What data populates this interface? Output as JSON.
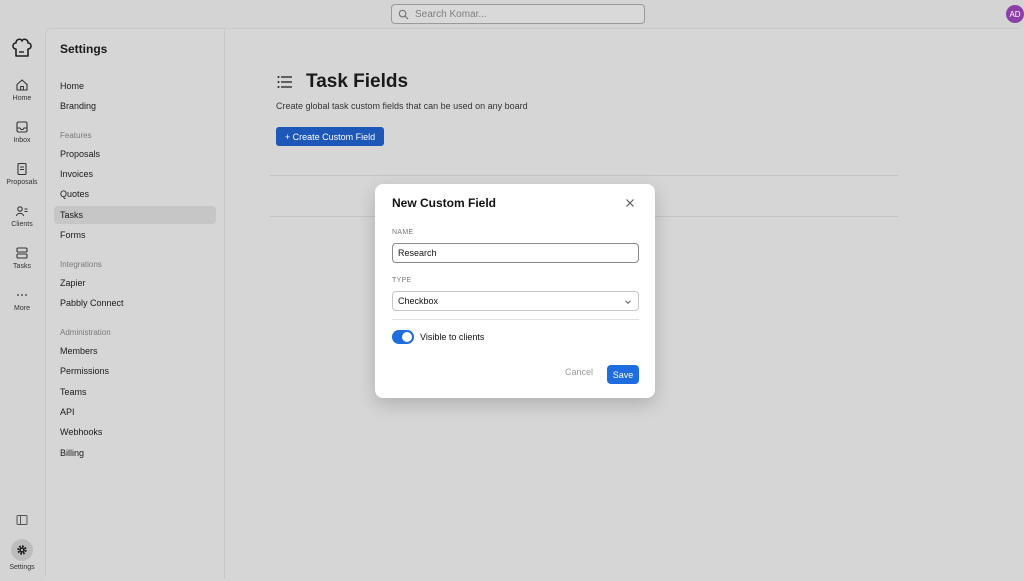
{
  "topbar": {
    "search_placeholder": "Search Komar...",
    "avatar_initials": "AD"
  },
  "rail": {
    "items": [
      {
        "label": "Home",
        "icon": "home-icon"
      },
      {
        "label": "Inbox",
        "icon": "inbox-icon"
      },
      {
        "label": "Proposals",
        "icon": "proposals-icon"
      },
      {
        "label": "Clients",
        "icon": "clients-icon"
      },
      {
        "label": "Tasks",
        "icon": "tasks-icon"
      },
      {
        "label": "More",
        "icon": "more-icon"
      }
    ],
    "settings_label": "Settings"
  },
  "settings": {
    "title": "Settings",
    "top_items": [
      "Home",
      "Branding"
    ],
    "groups": {
      "features": {
        "label": "Features",
        "items": [
          "Proposals",
          "Invoices",
          "Quotes",
          "Tasks",
          "Forms"
        ]
      },
      "integrations": {
        "label": "Integrations",
        "items": [
          "Zapier",
          "Pabbly Connect"
        ]
      },
      "administration": {
        "label": "Administration",
        "items": [
          "Members",
          "Permissions",
          "Teams",
          "API",
          "Webhooks",
          "Billing"
        ]
      }
    },
    "active": "Tasks"
  },
  "main": {
    "title": "Task Fields",
    "subtitle": "Create global task custom fields that can be used on any board",
    "create_button": "+ Create Custom Field"
  },
  "modal": {
    "title": "New Custom Field",
    "name_label": "NAME",
    "name_value": "Research",
    "type_label": "TYPE",
    "type_value": "Checkbox",
    "toggle_label": "Visible to clients",
    "toggle_on": true,
    "cancel_label": "Cancel",
    "save_label": "Save"
  },
  "colors": {
    "primary": "#1d57b8",
    "toggle": "#1d6ce0",
    "avatar": "#8b3fa8"
  }
}
